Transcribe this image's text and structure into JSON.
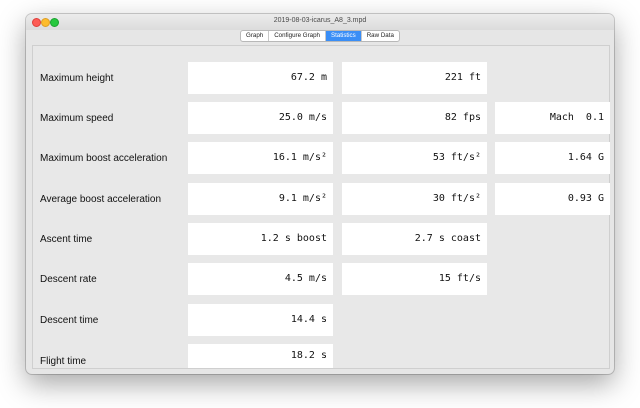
{
  "window": {
    "title": "2019-08-03-icarus_A8_3.mpd"
  },
  "tabs": [
    {
      "label": "Graph",
      "active": false
    },
    {
      "label": "Configure Graph",
      "active": false
    },
    {
      "label": "Statistics",
      "active": true
    },
    {
      "label": "Raw Data",
      "active": false
    }
  ],
  "colors": {
    "accent": "#3a8ef6",
    "window_bg": "#e6e6e6",
    "cell_bg": "#ffffff"
  },
  "stats": {
    "rows": [
      {
        "label": "Maximum height",
        "v1": "67.2 m",
        "v2": "221 ft",
        "v3": ""
      },
      {
        "label": "Maximum speed",
        "v1": "25.0 m/s",
        "v2": "82 fps",
        "v3": "Mach  0.1"
      },
      {
        "label": "Maximum boost acceleration",
        "v1": "16.1 m/s²",
        "v2": "53 ft/s²",
        "v3": "1.64 G"
      },
      {
        "label": "Average boost acceleration",
        "v1": "9.1 m/s²",
        "v2": "30 ft/s²",
        "v3": "0.93 G"
      },
      {
        "label": "Ascent time",
        "v1": "1.2 s boost",
        "v2": "2.7 s coast",
        "v3": ""
      },
      {
        "label": "Descent rate",
        "v1": "4.5 m/s",
        "v2": "15 ft/s",
        "v3": ""
      },
      {
        "label": "Descent time",
        "v1": "14.4 s",
        "v2": "",
        "v3": ""
      },
      {
        "label": "Flight time",
        "v1": "18.2 s",
        "v2": "",
        "v3": ""
      }
    ]
  }
}
